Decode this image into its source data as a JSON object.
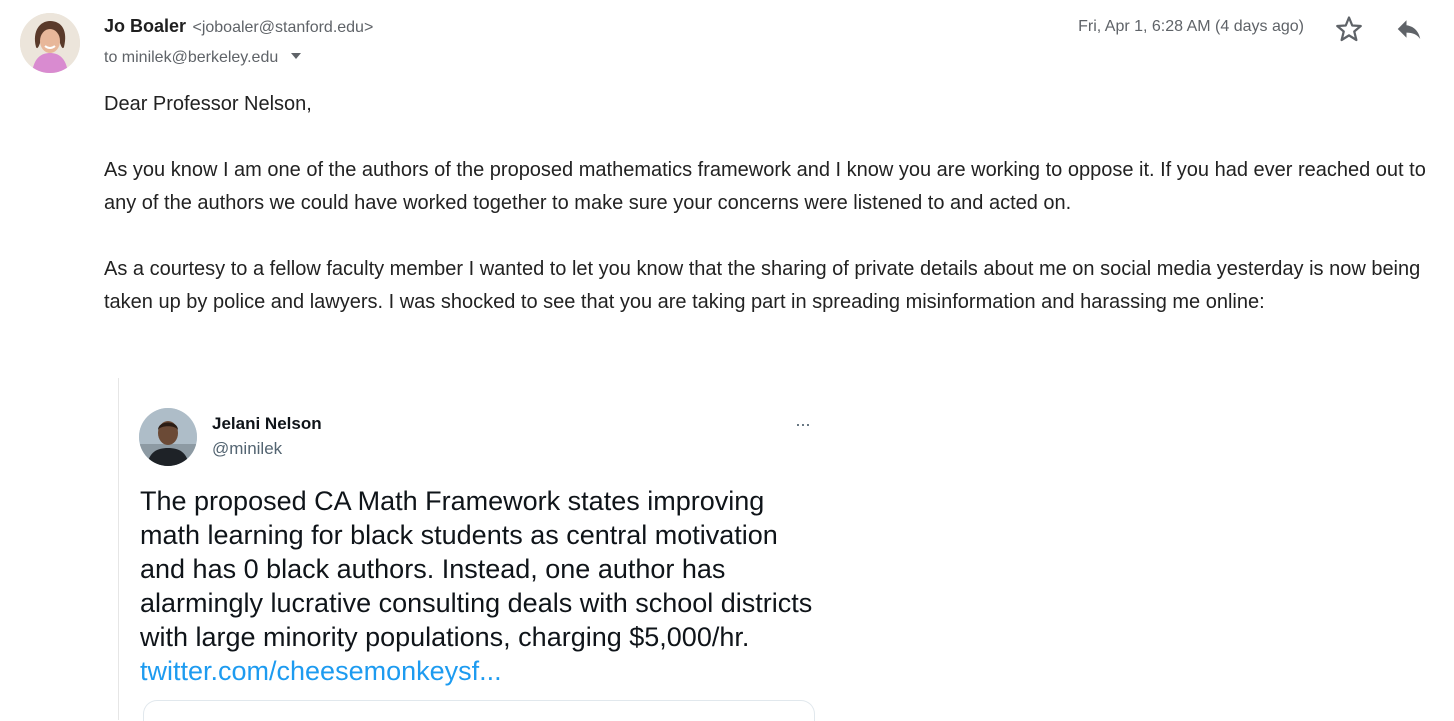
{
  "header": {
    "sender_name": "Jo Boaler",
    "sender_email": "<joboaler@stanford.edu>",
    "recipient": "to minilek@berkeley.edu",
    "date": "Fri, Apr 1, 6:28 AM (4 days ago)"
  },
  "icons": {
    "star": "star-outline-icon",
    "reply": "reply-arrow-icon",
    "caret": "caret-down-icon",
    "more": "more-horizontal-icon"
  },
  "body": {
    "greeting": "Dear Professor Nelson,",
    "paragraph1": "As you know I am one of the authors of the proposed mathematics framework and I know you are working to oppose it. If you had ever reached out to any of the authors we could have worked together to make sure your concerns were listened to and acted on.",
    "paragraph2": "As a courtesy to a fellow faculty member I wanted to let you know that the sharing of private details about me on social media yesterday is now being taken up by police and lawyers. I was shocked to see that you are taking part in spreading misinformation and harassing me online:"
  },
  "tweet": {
    "name": "Jelani Nelson",
    "handle": "@minilek",
    "more": "···",
    "text": "The proposed CA Math Framework states improving math learning for black students as central motivation and has 0 black authors. Instead, one author has alarmingly lucrative consulting deals with school districts with large minority populations, charging $5,000/hr. ",
    "link": "twitter.com/cheesemonkeysf..."
  },
  "colors": {
    "link": "#1d9bf0",
    "secondary_text": "#5f6368",
    "body_text": "#222222"
  }
}
